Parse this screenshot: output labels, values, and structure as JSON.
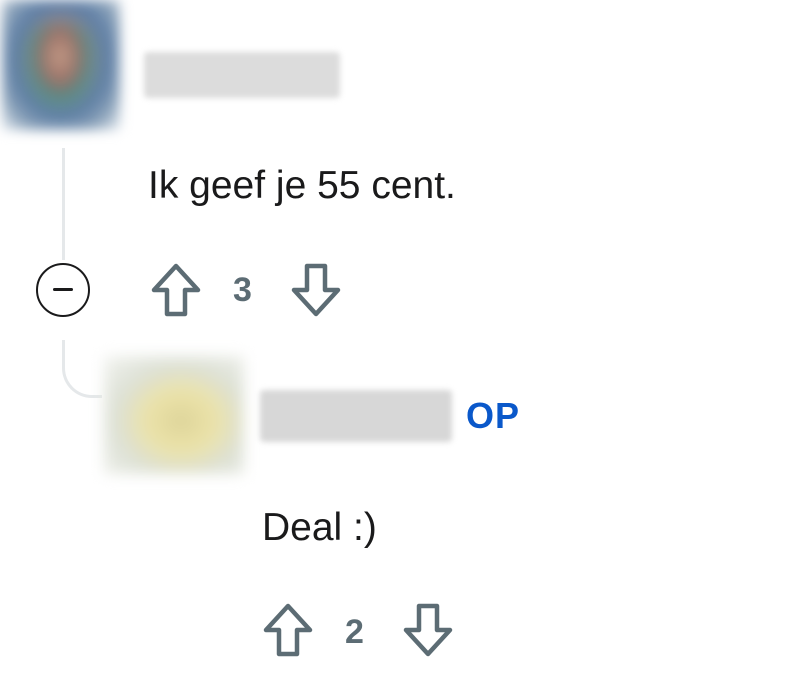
{
  "thread": {
    "comments": [
      {
        "text": "Ik geef je 55 cent.",
        "score": "3",
        "is_op": false
      },
      {
        "text": "Deal :)",
        "score": "2",
        "is_op": true,
        "op_label": "OP"
      }
    ]
  },
  "colors": {
    "op_badge": "#0a58ca",
    "vote_icon": "#5c6c74",
    "text": "#1a1a1b",
    "thread_line": "#e5e8ea"
  },
  "icons": {
    "upvote": "arrow-up-outline-icon",
    "downvote": "arrow-down-outline-icon",
    "collapse": "minus-circle-icon"
  }
}
